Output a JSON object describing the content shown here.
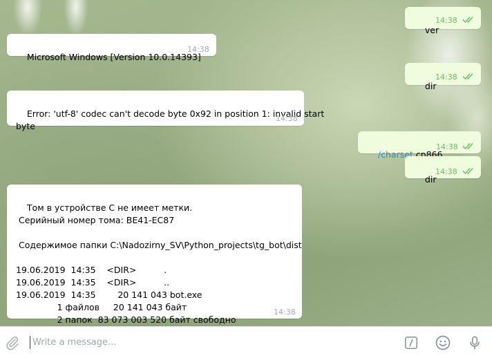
{
  "messages": [
    {
      "id": "m1",
      "direction": "out",
      "text": "ver",
      "time": "14:38"
    },
    {
      "id": "m2",
      "direction": "in",
      "text": "Microsoft Windows [Version 10.0.14393]",
      "time": "14:38"
    },
    {
      "id": "m3",
      "direction": "out",
      "text": "dir",
      "time": "14:38"
    },
    {
      "id": "m4",
      "direction": "in",
      "text": "Error: 'utf-8' codec can't decode byte 0x92 in position 1: invalid start\nbyte",
      "time": "14:38"
    },
    {
      "id": "m5",
      "direction": "out",
      "command": "/charset",
      "argument": " cp866",
      "time": "14:38"
    },
    {
      "id": "m6",
      "direction": "out",
      "text": "dir",
      "time": "14:38"
    },
    {
      "id": "m7",
      "direction": "in",
      "text": "Том в устройстве C не имеет метки.\n Серийный номер тома: BE41-EC87\n\n Содержимое папки C:\\Nadozirny_SV\\Python_projects\\tg_bot\\dist\n\n19.06.2019  14:35    <DIR>          .\n19.06.2019  14:35    <DIR>          ..\n19.06.2019  14:35        20 141 043 bot.exe\n               1 файлов     20 141 043 байт\n               2 папок  83 073 003 520 байт свободно",
      "time": "14:38"
    }
  ],
  "input": {
    "placeholder": "Write a message...",
    "value": ""
  },
  "icons": {
    "attach": "paperclip-icon",
    "commands": "slash-command-icon",
    "emoji": "smiley-icon",
    "voice": "microphone-icon",
    "read_status": "double-check-icon"
  },
  "colors": {
    "incoming_bubble": "#ffffff",
    "outgoing_bubble": "#effdde",
    "outgoing_time": "#6cbd67",
    "incoming_time": "#a0acb6",
    "command_link": "#2f8ac9"
  }
}
